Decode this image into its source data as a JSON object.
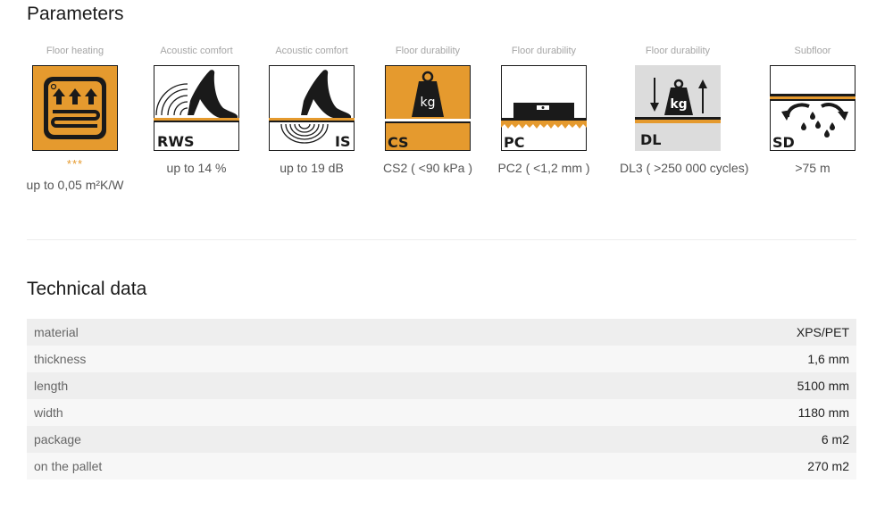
{
  "parameters": {
    "title": "Parameters",
    "items": [
      {
        "caption": "Floor heating",
        "icon": "floor-heating-icon",
        "stars": "***",
        "value": "up to 0,05 m²K/W"
      },
      {
        "caption": "Acoustic comfort",
        "icon": "rws-icon",
        "icon_label": "RWS",
        "value": "up to 14 %"
      },
      {
        "caption": "Acoustic comfort",
        "icon": "is-icon",
        "icon_label": "IS",
        "value": "up to 19 dB"
      },
      {
        "caption": "Floor durability",
        "icon": "cs-icon",
        "icon_label": "CS",
        "icon_weight": "kg",
        "value": "CS2 ( <90 kPa )"
      },
      {
        "caption": "Floor durability",
        "icon": "pc-icon",
        "icon_label": "PC",
        "value": "PC2 ( <1,2 mm )"
      },
      {
        "caption": "Floor durability",
        "icon": "dl-icon",
        "icon_label": "DL",
        "icon_weight": "kg",
        "value": "DL3 ( >250 000 cycles)"
      },
      {
        "caption": "Subfloor",
        "icon": "sd-icon",
        "icon_label": "SD",
        "value": ">75 m"
      }
    ]
  },
  "technical": {
    "title": "Technical data",
    "rows": [
      {
        "key": "material",
        "value": "XPS/PET"
      },
      {
        "key": "thickness",
        "value": "1,6 mm"
      },
      {
        "key": "length",
        "value": "5100 mm"
      },
      {
        "key": "width",
        "value": "1180 mm"
      },
      {
        "key": "package",
        "value": "6 m2"
      },
      {
        "key": "on the pallet",
        "value": "270 m2"
      }
    ]
  },
  "colors": {
    "accent": "#E59A2E",
    "icon_dark": "#1a1a1a",
    "table_row_odd": "#EEEEEE",
    "table_row_even": "#F7F7F7"
  }
}
